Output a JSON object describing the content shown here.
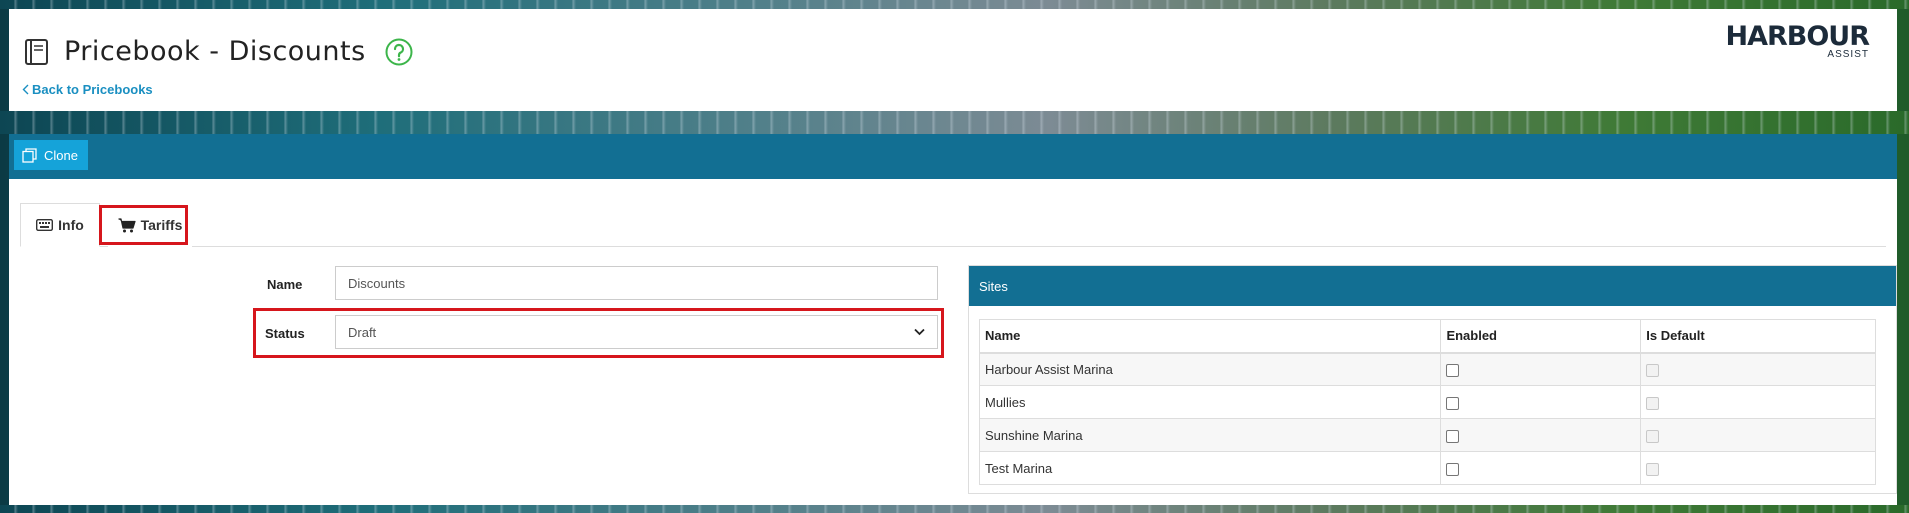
{
  "header": {
    "title": "Pricebook - Discounts",
    "back_link": "Back to Pricebooks",
    "logo_main": "HARBOUR",
    "logo_sub": "ASSIST"
  },
  "toolbar": {
    "clone_label": "Clone"
  },
  "tabs": [
    {
      "label": "Info",
      "icon": "keyboard-icon",
      "active": true
    },
    {
      "label": "Tariffs",
      "icon": "cart-icon",
      "active": false
    }
  ],
  "form": {
    "name_label": "Name",
    "name_value": "Discounts",
    "status_label": "Status",
    "status_value": "Draft"
  },
  "sites": {
    "title": "Sites",
    "columns": [
      "Name",
      "Enabled",
      "Is Default"
    ],
    "rows": [
      {
        "name": "Harbour Assist Marina",
        "enabled": false,
        "is_default": false
      },
      {
        "name": "Mullies",
        "enabled": false,
        "is_default": false
      },
      {
        "name": "Sunshine Marina",
        "enabled": false,
        "is_default": false
      },
      {
        "name": "Test Marina",
        "enabled": false,
        "is_default": false
      }
    ]
  },
  "colors": {
    "toolbar": "#126f93",
    "clone_button": "#15a3d9",
    "link": "#1a8fc1",
    "help_icon": "#3cb54a",
    "highlight": "#d6161c"
  }
}
